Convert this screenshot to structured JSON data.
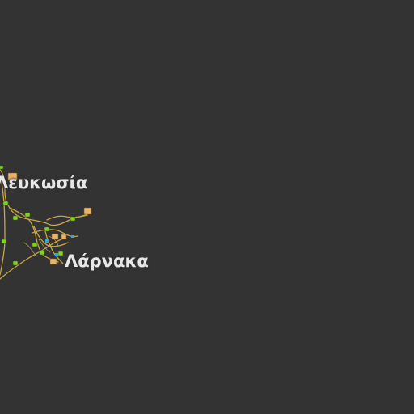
{
  "map": {
    "background_color": "#333333",
    "road_color": "#c9a545",
    "junction_color": "#7ed321",
    "poi_color": "#e8b46c",
    "water_poi_color": "#33a6e0",
    "cities": [
      {
        "id": "lefkosia",
        "label": "Λευκωσία"
      },
      {
        "id": "larnaka",
        "label": "Λάρνακα"
      }
    ]
  }
}
